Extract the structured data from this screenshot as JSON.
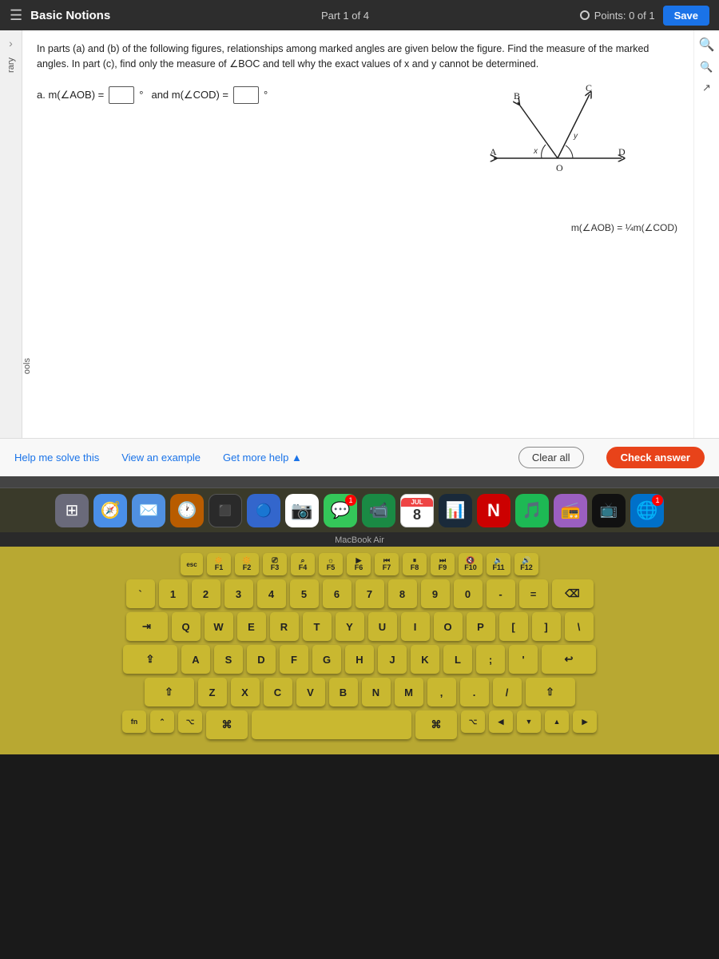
{
  "appBar": {
    "hamburger": "☰",
    "title": "Basic Notions",
    "partIndicator": "Part 1 of 4",
    "points": "Points: 0 of 1",
    "saveLabel": "Save"
  },
  "problem": {
    "instruction": "In parts (a) and (b) of the following figures, relationships among marked angles are given below the figure. Find the measure of the marked angles. In part (c), find only the measure of ∠BOC and tell why the exact values of x and y cannot be determined.",
    "partA": {
      "label": "a. m(∠AOB) =",
      "unit1": "°",
      "and": "and m(∠COD) =",
      "unit2": "°"
    },
    "equation": "m(∠AOB) = ¼m(∠COD)"
  },
  "actions": {
    "helpLabel": "Help me solve this",
    "exampleLabel": "View an example",
    "moreHelpLabel": "Get more help ▲",
    "clearLabel": "Clear all",
    "checkLabel": "Check answer"
  },
  "dock": [
    {
      "icon": "⊞",
      "label": "Launchpad",
      "color": "#6a6a7a"
    },
    {
      "icon": "🧭",
      "label": "Finder",
      "color": "#4a8fe8"
    },
    {
      "icon": "✉️",
      "label": "Mail",
      "color": "#5090e0"
    },
    {
      "icon": "🕐",
      "label": "Clock",
      "color": "#b85c00",
      "badge": ""
    },
    {
      "icon": "⬛",
      "label": "Terminal",
      "color": "#333"
    },
    {
      "icon": "🔵",
      "label": "Launchpad2",
      "color": "#4488cc"
    },
    {
      "icon": "📷",
      "label": "Photos",
      "color": "#e87040"
    },
    {
      "icon": "💬",
      "label": "Messages",
      "color": "#34c759",
      "badge": ""
    },
    {
      "icon": "📹",
      "label": "Facetime",
      "color": "#34c759"
    },
    {
      "icon": "📅",
      "label": "Calendar",
      "color": "#f44"
    },
    {
      "icon": "📊",
      "label": "Stocks",
      "color": "#555"
    },
    {
      "icon": "🎵",
      "label": "Music",
      "color": "#fa243c"
    },
    {
      "icon": "N",
      "label": "N",
      "color": "#cc0000"
    },
    {
      "icon": "🎵",
      "label": "Music2",
      "color": "#1db954"
    },
    {
      "icon": "📻",
      "label": "Podcast",
      "color": "#9b5fc0"
    },
    {
      "icon": "📺",
      "label": "Apple TV",
      "color": "#111"
    },
    {
      "icon": "🌐",
      "label": "Safari",
      "color": "#0070c9",
      "badge": "1"
    }
  ],
  "macbookLabel": "MacBook Air",
  "keyboard": {
    "rows": [
      [
        "esc",
        "F1",
        "F2",
        "F3",
        "F4",
        "F5",
        "F6",
        "F7",
        "F8",
        "F9",
        "F10",
        "F11",
        "F12"
      ],
      [
        "`",
        "1",
        "2",
        "3",
        "4",
        "5",
        "6",
        "7",
        "8",
        "9",
        "0",
        "-",
        "=",
        "⌫"
      ],
      [
        "⇥",
        "Q",
        "W",
        "E",
        "R",
        "T",
        "Y",
        "U",
        "I",
        "O",
        "P",
        "[",
        "]",
        "\\"
      ],
      [
        "⇪",
        "A",
        "S",
        "D",
        "F",
        "G",
        "H",
        "J",
        "K",
        "L",
        ";",
        "'",
        "↩"
      ],
      [
        "⇧",
        "Z",
        "X",
        "C",
        "V",
        "B",
        "N",
        "M",
        ",",
        ".",
        "/",
        "⇧"
      ],
      [
        "fn",
        "⌃",
        "⌥",
        "⌘",
        "space",
        "⌘",
        "⌥",
        "◀",
        "▼",
        "▲",
        "▶"
      ]
    ]
  }
}
